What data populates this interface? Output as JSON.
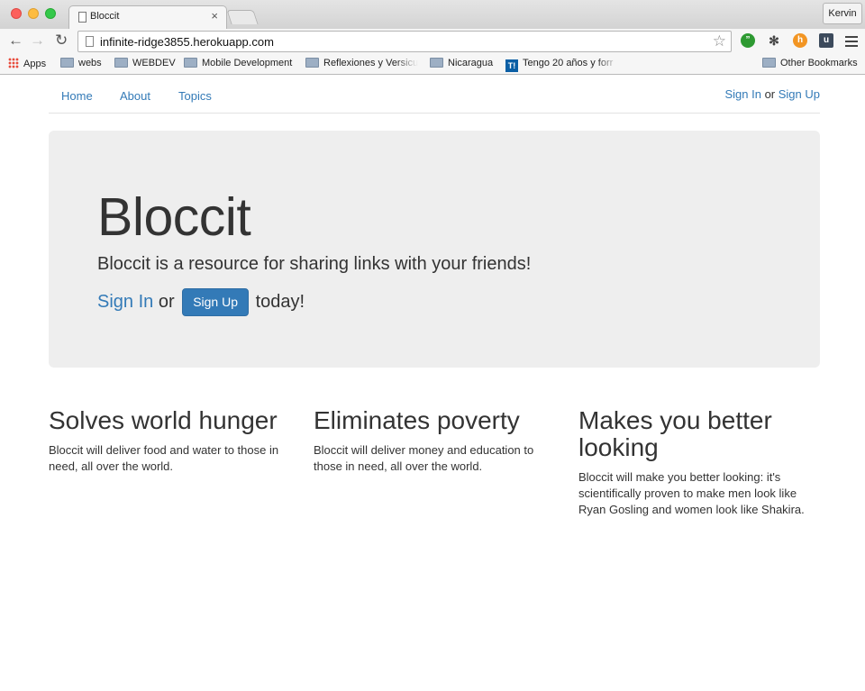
{
  "browser": {
    "tab_title": "Bloccit",
    "tab_close": "×",
    "profile_name": "Kervin",
    "url": "infinite-ridge3855.herokuapp.com",
    "bookmarks": [
      {
        "label": "Apps",
        "icon": "apps-icon"
      },
      {
        "label": "webs",
        "icon": "folder-icon"
      },
      {
        "label": "WEBDEV",
        "icon": "folder-icon"
      },
      {
        "label": "Mobile Development",
        "icon": "folder-icon"
      },
      {
        "label": "Reflexiones y Versicu",
        "icon": "folder-icon"
      },
      {
        "label": "Nicaragua",
        "icon": "folder-icon"
      },
      {
        "label": "Tengo 20 años y forr",
        "icon": "t-icon"
      },
      {
        "label": "Other Bookmarks",
        "icon": "folder-icon"
      }
    ]
  },
  "nav": {
    "home": "Home",
    "about": "About",
    "topics": "Topics",
    "sign_in": "Sign In",
    "or": "or",
    "sign_up": "Sign Up"
  },
  "hero": {
    "title": "Bloccit",
    "lead": "Bloccit is a resource for sharing links with your friends!",
    "sign_in": "Sign In",
    "or": "or",
    "sign_up_button": "Sign Up",
    "today": "today!"
  },
  "features": [
    {
      "title": "Solves world hunger",
      "text": "Bloccit will deliver food and water to those in need, all over the world."
    },
    {
      "title": "Eliminates poverty",
      "text": "Bloccit will deliver money and education to those in need, all over the world."
    },
    {
      "title": "Makes you better looking",
      "text": "Bloccit will make you better looking: it's scientifically proven to make men look like Ryan Gosling and women look like Shakira."
    }
  ],
  "colors": {
    "link": "#337ab7",
    "button": "#337ab7",
    "jumbotron": "#eeeeee"
  }
}
